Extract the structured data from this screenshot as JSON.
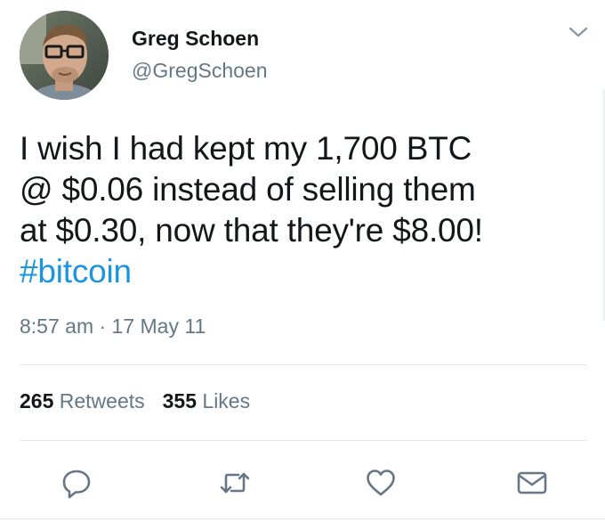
{
  "author": {
    "name": "Greg Schoen",
    "handle": "@GregSchoen"
  },
  "tweet": {
    "lines": [
      "I wish I had kept my 1,700 BTC",
      "@ $0.06 instead of selling them",
      "at $0.30, now that they're $8.00!"
    ],
    "hashtag": "#bitcoin",
    "timestamp": "8:57 am · 17 May 11"
  },
  "stats": {
    "retweets_count": "265",
    "retweets_label": "Retweets",
    "likes_count": "355",
    "likes_label": "Likes"
  },
  "icons": {
    "caret": "chevron-down-icon",
    "reply": "reply-icon",
    "retweet": "retweet-icon",
    "like": "heart-icon",
    "dm": "envelope-icon"
  },
  "colors": {
    "text": "#14171a",
    "secondary": "#657786",
    "link": "#1b95e0",
    "divider": "#e1e8ed"
  }
}
